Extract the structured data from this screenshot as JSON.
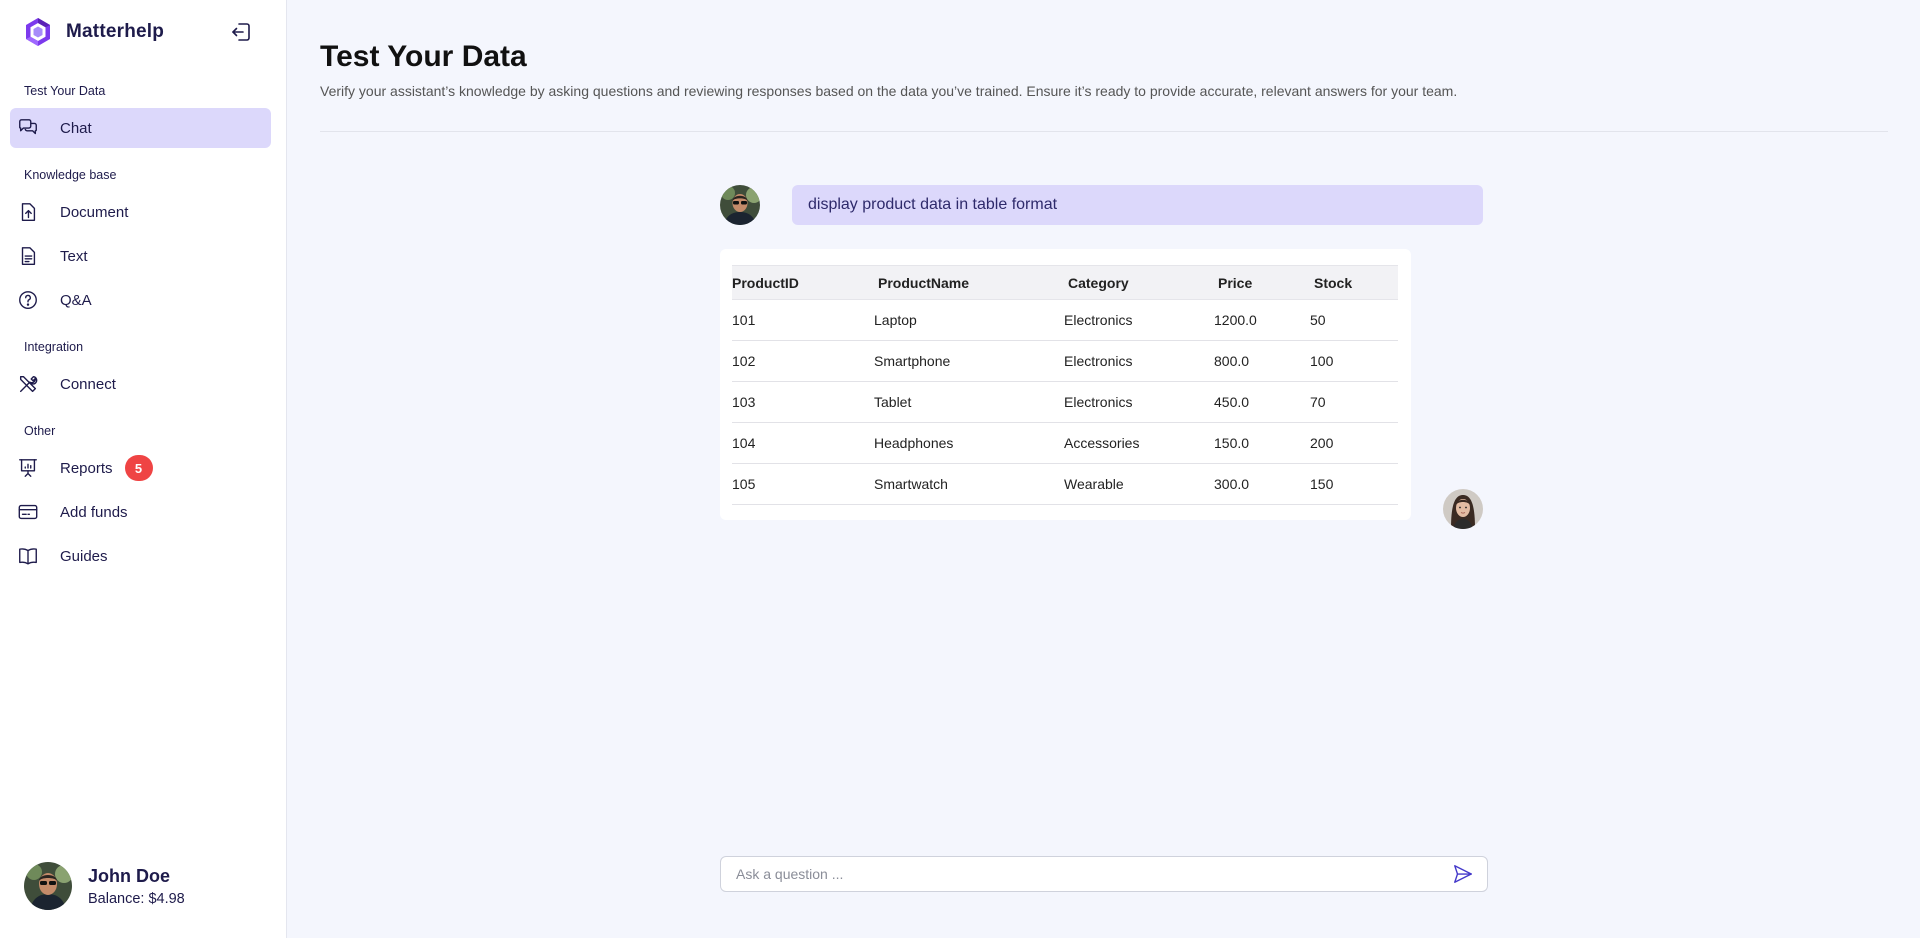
{
  "app": {
    "name": "Matterhelp",
    "brand_color": "#7c3aed",
    "accent_color": "#dcd8fb"
  },
  "sidebar": {
    "sections": [
      {
        "label": "Test Your Data"
      },
      {
        "label": "Knowledge base"
      },
      {
        "label": "Integration"
      },
      {
        "label": "Other"
      }
    ],
    "items": [
      {
        "label": "Chat",
        "icon": "chat-bubbles-icon",
        "active": true
      },
      {
        "label": "Document",
        "icon": "document-upload-icon"
      },
      {
        "label": "Text",
        "icon": "text-file-icon"
      },
      {
        "label": "Q&A",
        "icon": "question-circle-icon"
      },
      {
        "label": "Connect",
        "icon": "tools-icon"
      },
      {
        "label": "Reports",
        "icon": "presentation-chart-icon",
        "badge": "5"
      },
      {
        "label": "Add funds",
        "icon": "credit-card-icon"
      },
      {
        "label": "Guides",
        "icon": "book-open-icon"
      }
    ]
  },
  "user": {
    "name": "John Doe",
    "balance": "Balance: $4.98"
  },
  "header": {
    "title": "Test Your Data",
    "subtitle": "Verify your assistant’s knowledge by asking questions and reviewing responses based on the data you’ve trained. Ensure it’s ready to provide accurate, relevant answers for your team."
  },
  "chat": {
    "user_message": "display product data in table format",
    "table": {
      "headers": [
        "ProductID",
        "ProductName",
        "Category",
        "Price",
        "Stock"
      ],
      "rows": [
        [
          "101",
          "Laptop",
          "Electronics",
          "1200.0",
          "50"
        ],
        [
          "102",
          "Smartphone",
          "Electronics",
          "800.0",
          "100"
        ],
        [
          "103",
          "Tablet",
          "Electronics",
          "450.0",
          "70"
        ],
        [
          "104",
          "Headphones",
          "Accessories",
          "150.0",
          "200"
        ],
        [
          "105",
          "Smartwatch",
          "Wearable",
          "300.0",
          "150"
        ]
      ]
    }
  },
  "input": {
    "placeholder": "Ask a question ..."
  }
}
